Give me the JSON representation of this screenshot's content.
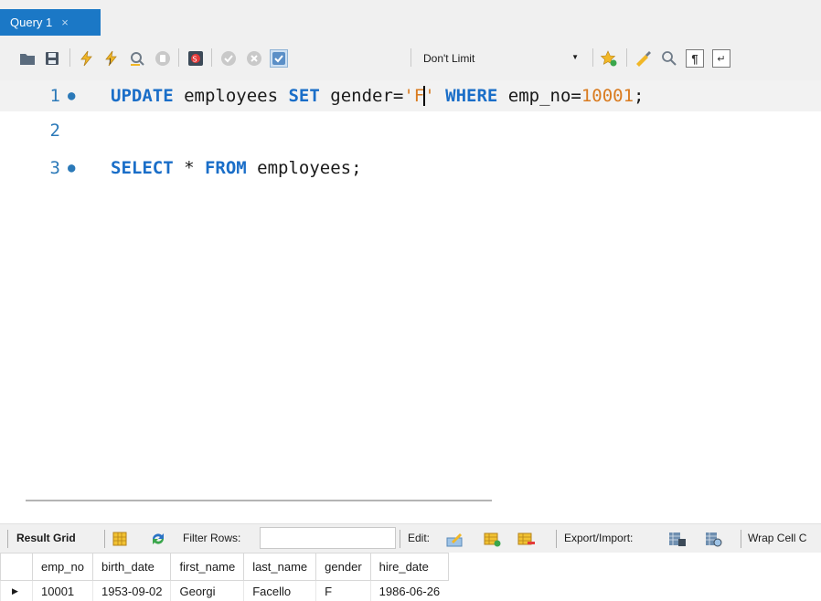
{
  "tab": {
    "title": "Query 1",
    "close": "×"
  },
  "toolbar": {
    "limit_value": "Don't Limit"
  },
  "editor": {
    "lines": [
      {
        "number": "1",
        "marker": "●"
      },
      {
        "number": "2",
        "marker": ""
      },
      {
        "number": "3",
        "marker": "●"
      }
    ],
    "line1": {
      "kw_update": "UPDATE",
      "t1": " employees ",
      "kw_set": "SET",
      "t2": " gender=",
      "str_open": "'F",
      "str_close": "'",
      "t3": " ",
      "kw_where": "WHERE",
      "t4": " emp_no=",
      "num": "10001",
      "t5": ";"
    },
    "line3": {
      "kw_select": "SELECT",
      "t1": " * ",
      "kw_from": "FROM",
      "t2": " employees;"
    }
  },
  "result_toolbar": {
    "result_grid": "Result Grid",
    "filter_rows": "Filter Rows:",
    "filter_value": "",
    "edit": "Edit:",
    "export_import": "Export/Import:",
    "wrap_cell": "Wrap Cell C"
  },
  "grid": {
    "columns": [
      "emp_no",
      "birth_date",
      "first_name",
      "last_name",
      "gender",
      "hire_date"
    ],
    "rows": [
      {
        "marker": "▶",
        "cells": [
          "10001",
          "1953-09-02",
          "Georgi",
          "Facello",
          "F",
          "1986-06-26"
        ]
      }
    ]
  },
  "colors": {
    "tab_active": "#1b78c6",
    "keyword": "#1a6ec8",
    "string_number": "#d97b1f",
    "line_number": "#2b79b8"
  }
}
